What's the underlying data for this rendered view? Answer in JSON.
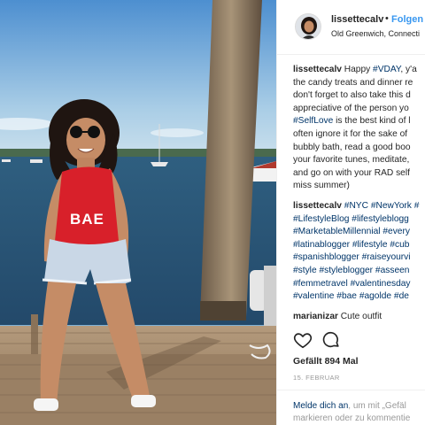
{
  "post": {
    "username": "lissettecalv",
    "separator": "•",
    "follow_label": "Folgen",
    "location": "Old Greenwich, Connecti",
    "caption_lines": [
      [
        {
          "t": "user",
          "v": "lissettecalv"
        },
        {
          "t": "text",
          "v": " Happy "
        },
        {
          "t": "tag",
          "v": "#VDAY"
        },
        {
          "t": "text",
          "v": ", y'a"
        }
      ],
      [
        {
          "t": "text",
          "v": "the candy treats and dinner re"
        }
      ],
      [
        {
          "t": "text",
          "v": "don't forget to also take this d"
        }
      ],
      [
        {
          "t": "text",
          "v": "appreciative of the person yo"
        }
      ],
      [
        {
          "t": "tag",
          "v": "#SelfLove"
        },
        {
          "t": "text",
          "v": " is the best kind of l"
        }
      ],
      [
        {
          "t": "text",
          "v": "often ignore it for the sake of"
        }
      ],
      [
        {
          "t": "text",
          "v": "bubbly bath, read a good boo"
        }
      ],
      [
        {
          "t": "text",
          "v": "your favorite tunes, meditate,"
        }
      ],
      [
        {
          "t": "text",
          "v": "and go on with your RAD self"
        }
      ],
      [
        {
          "t": "text",
          "v": "miss summer)"
        }
      ]
    ],
    "hashtag_lines": [
      [
        {
          "t": "user",
          "v": "lissettecalv"
        },
        {
          "t": "text",
          "v": " "
        },
        {
          "t": "tag",
          "v": "#NYC"
        },
        {
          "t": "text",
          "v": " "
        },
        {
          "t": "tag",
          "v": "#NewYork"
        },
        {
          "t": "text",
          "v": " "
        },
        {
          "t": "tag",
          "v": "#"
        }
      ],
      [
        {
          "t": "tag",
          "v": "#LifestyleBlog"
        },
        {
          "t": "text",
          "v": " "
        },
        {
          "t": "tag",
          "v": "#lifestyleblogg"
        }
      ],
      [
        {
          "t": "tag",
          "v": "#MarketableMillennial"
        },
        {
          "t": "text",
          "v": " "
        },
        {
          "t": "tag",
          "v": "#every"
        }
      ],
      [
        {
          "t": "tag",
          "v": "#latinablogger"
        },
        {
          "t": "text",
          "v": " "
        },
        {
          "t": "tag",
          "v": "#lifestyle"
        },
        {
          "t": "text",
          "v": " "
        },
        {
          "t": "tag",
          "v": "#cub"
        }
      ],
      [
        {
          "t": "tag",
          "v": "#spanishblogger"
        },
        {
          "t": "text",
          "v": " "
        },
        {
          "t": "tag",
          "v": "#raiseyourvi"
        }
      ],
      [
        {
          "t": "tag",
          "v": "#style"
        },
        {
          "t": "text",
          "v": " "
        },
        {
          "t": "tag",
          "v": "#styleblogger"
        },
        {
          "t": "text",
          "v": " "
        },
        {
          "t": "tag",
          "v": "#asseen"
        }
      ],
      [
        {
          "t": "tag",
          "v": "#femmetravel"
        },
        {
          "t": "text",
          "v": " "
        },
        {
          "t": "tag",
          "v": "#valentinesday"
        }
      ],
      [
        {
          "t": "tag",
          "v": "#valentine"
        },
        {
          "t": "text",
          "v": " "
        },
        {
          "t": "tag",
          "v": "#bae"
        },
        {
          "t": "text",
          "v": " "
        },
        {
          "t": "tag",
          "v": "#agolde"
        },
        {
          "t": "text",
          "v": " "
        },
        {
          "t": "tag",
          "v": "#de"
        }
      ]
    ],
    "comment": {
      "user": "marianizar",
      "text": " Cute outfit"
    },
    "likes": "Gefällt 894 Mal",
    "date": "15. FEBRUAR",
    "login": {
      "link": "Melde dich an",
      "line1_rest": ", um mit „Gefäl",
      "line2": "markieren oder zu kommentie"
    },
    "photo_text": "BAE",
    "icons": {
      "like": "heart-icon",
      "comment": "comment-bubble-icon"
    },
    "colors": {
      "link": "#3897f0",
      "hashtag": "#003569",
      "text": "#262626",
      "muted": "#999999",
      "swimsuit": "#d8202a"
    }
  }
}
